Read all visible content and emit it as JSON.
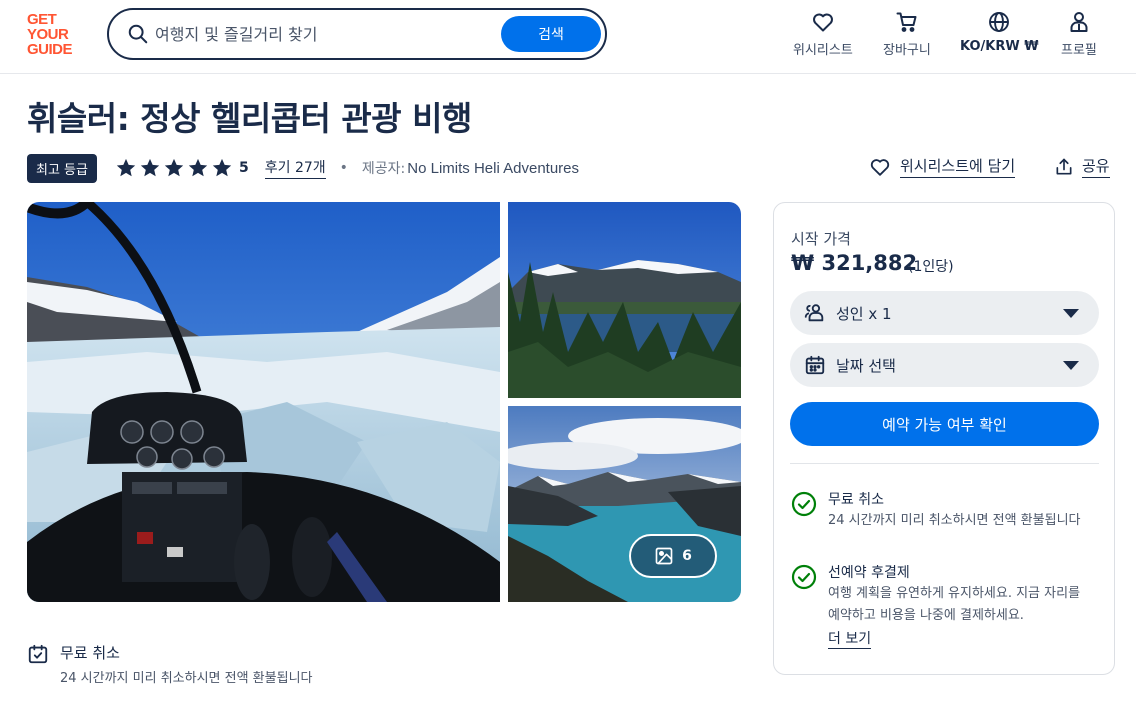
{
  "header": {
    "logo_lines": [
      "GET",
      "YOUR",
      "GUIDE"
    ],
    "search_placeholder": "여행지 및 즐길거리 찾기",
    "search_button": "검색",
    "nav": [
      {
        "label": "위시리스트",
        "icon": "heart-icon"
      },
      {
        "label": "장바구니",
        "icon": "cart-icon"
      },
      {
        "label": "KO/KRW ₩",
        "icon": "globe-icon"
      },
      {
        "label": "프로필",
        "icon": "person-icon"
      }
    ]
  },
  "activity": {
    "title": "휘슬러: 정상 헬리콥터 관광 비행",
    "badge": "최고 등급",
    "rating": "5",
    "stars": 5,
    "reviews_label": "후기 27개",
    "provider_label": "제공자:",
    "provider_name": "No Limits Heli Adventures",
    "wishlist_action": "위시리스트에 담기",
    "share_action": "공유"
  },
  "gallery": {
    "photo_count": "6"
  },
  "free_cancel_bottom": {
    "title": "무료 취소",
    "desc": "24 시간까지 미리 취소하시면 전액 환불됩니다"
  },
  "booking": {
    "price_label": "시작 가격",
    "price": "₩ 321,882",
    "per": "(1인당)",
    "participants": "성인 x 1",
    "date": "날짜 선택",
    "cta": "예약 가능 여부 확인",
    "features": [
      {
        "title": "무료 취소",
        "desc": "24 시간까지 미리 취소하시면 전액 환불됩니다"
      },
      {
        "title": "선예약 후결제",
        "desc": "여행 계획을 유연하게 유지하세요. 지금 자리를 예약하고 비용을 나중에 결제하세요."
      }
    ],
    "more": "더 보기"
  },
  "colors": {
    "brand": "#ff5533",
    "primary": "#0071eb",
    "navy": "#1a2b49",
    "success": "#008009"
  }
}
